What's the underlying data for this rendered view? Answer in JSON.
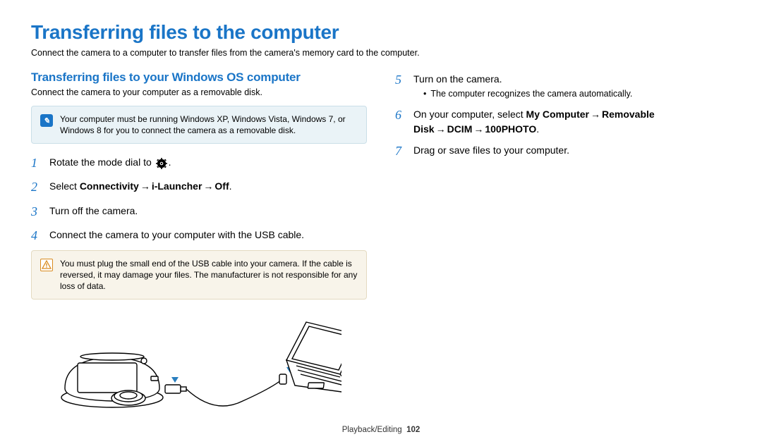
{
  "title": "Transferring files to the computer",
  "intro": "Connect the camera to a computer to transfer files from the camera's memory card to the computer.",
  "left": {
    "section_title": "Transferring files to your Windows OS computer",
    "subtext": "Connect the camera to your computer as a removable disk.",
    "info_callout": "Your computer must be running Windows XP, Windows Vista, Windows 7, or Windows 8 for you to connect the camera as a removable disk.",
    "step1": "Rotate the mode dial to ",
    "step1_end": ".",
    "step2_pre": "Select ",
    "step2_b1": "Connectivity",
    "step2_b2": "i-Launcher",
    "step2_b3": "Off",
    "step2_end": ".",
    "step3": "Turn off the camera.",
    "step4": "Connect the camera to your computer with the USB cable.",
    "warn_callout": "You must plug the small end of the USB cable into your camera. If the cable is reversed, it may damage your files. The manufacturer is not responsible for any loss of data."
  },
  "right": {
    "step5": "Turn on the camera.",
    "step5_sub": "The computer recognizes the camera automatically.",
    "step6_pre": "On your computer, select ",
    "step6_b1": "My Computer",
    "step6_b2": "Removable Disk",
    "step6_b3": "DCIM",
    "step6_b4": "100PHOTO",
    "step6_end": ".",
    "step7": "Drag or save files to your computer."
  },
  "footer": {
    "section": "Playback/Editing",
    "page": "102"
  },
  "arrow": "→"
}
